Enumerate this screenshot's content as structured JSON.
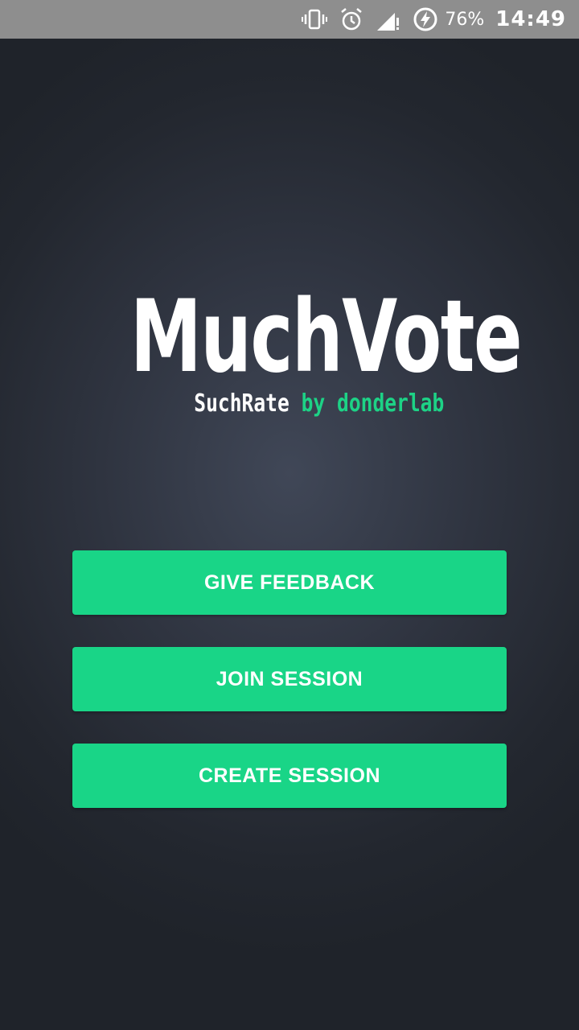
{
  "status_bar": {
    "battery_percent": "76%",
    "time": "14:49",
    "icons": [
      "vibrate-icon",
      "alarm-icon",
      "signal-icon",
      "battery-charging-icon"
    ]
  },
  "logo": {
    "title": "MuchVote",
    "subtitle_product": "SuchRate",
    "subtitle_by": "by donderlab"
  },
  "actions": {
    "give_feedback": "GIVE FEEDBACK",
    "join_session": "JOIN SESSION",
    "create_session": "CREATE SESSION"
  },
  "colors": {
    "accent": "#19d587",
    "background": "#22262f",
    "status_bar": "#8e8e8e"
  }
}
